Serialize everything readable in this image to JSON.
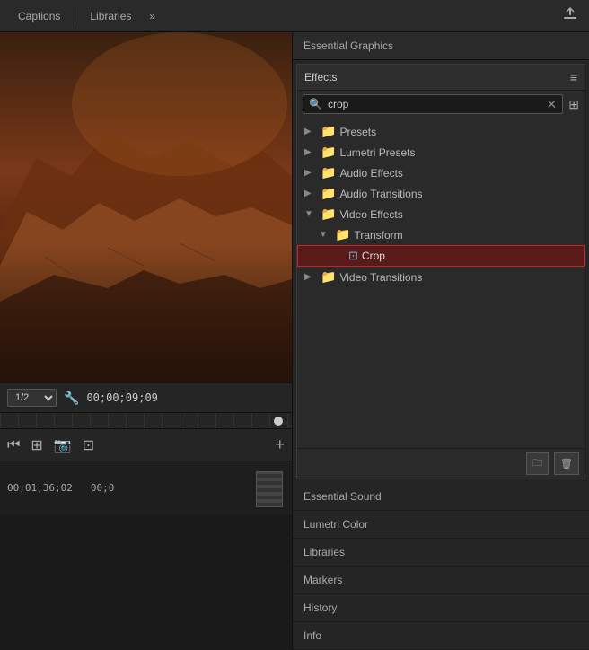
{
  "tabs": {
    "captions_label": "Captions",
    "libraries_label": "Libraries",
    "export_icon": "⬆",
    "more_icon": "»"
  },
  "preview": {
    "timecode": "00;00;09;09",
    "zoom": "1/2"
  },
  "effects_panel": {
    "essential_graphics_label": "Essential Graphics",
    "panel_title": "Effects",
    "menu_icon": "≡",
    "search_placeholder": "crop",
    "tree": [
      {
        "id": "presets",
        "indent": 0,
        "chevron": "▶",
        "label": "Presets",
        "icon": "folder",
        "expanded": false
      },
      {
        "id": "lumetri-presets",
        "indent": 0,
        "chevron": "▶",
        "label": "Lumetri Presets",
        "icon": "folder",
        "expanded": false
      },
      {
        "id": "audio-effects",
        "indent": 0,
        "chevron": "▶",
        "label": "Audio Effects",
        "icon": "folder",
        "expanded": false
      },
      {
        "id": "audio-transitions",
        "indent": 0,
        "chevron": "▶",
        "label": "Audio Transitions",
        "icon": "folder",
        "expanded": false
      },
      {
        "id": "video-effects",
        "indent": 0,
        "chevron": "▼",
        "label": "Video Effects",
        "icon": "folder",
        "expanded": true
      },
      {
        "id": "transform",
        "indent": 1,
        "chevron": "▼",
        "label": "Transform",
        "icon": "folder",
        "expanded": true
      },
      {
        "id": "crop",
        "indent": 2,
        "chevron": "",
        "label": "Crop",
        "icon": "effect",
        "highlighted": true
      },
      {
        "id": "video-transitions",
        "indent": 0,
        "chevron": "▶",
        "label": "Video Transitions",
        "icon": "folder",
        "expanded": false
      }
    ],
    "footer_new_folder_icon": "🗀",
    "footer_delete_icon": "🗑"
  },
  "bottom_sections": [
    {
      "id": "essential-sound",
      "label": "Essential Sound"
    },
    {
      "id": "lumetri-color",
      "label": "Lumetri Color"
    },
    {
      "id": "libraries",
      "label": "Libraries"
    },
    {
      "id": "markers",
      "label": "Markers"
    },
    {
      "id": "history",
      "label": "History"
    },
    {
      "id": "info",
      "label": "Info"
    }
  ],
  "timeline": {
    "timecode1": "00;01;36;02",
    "timecode2": "00;0"
  }
}
